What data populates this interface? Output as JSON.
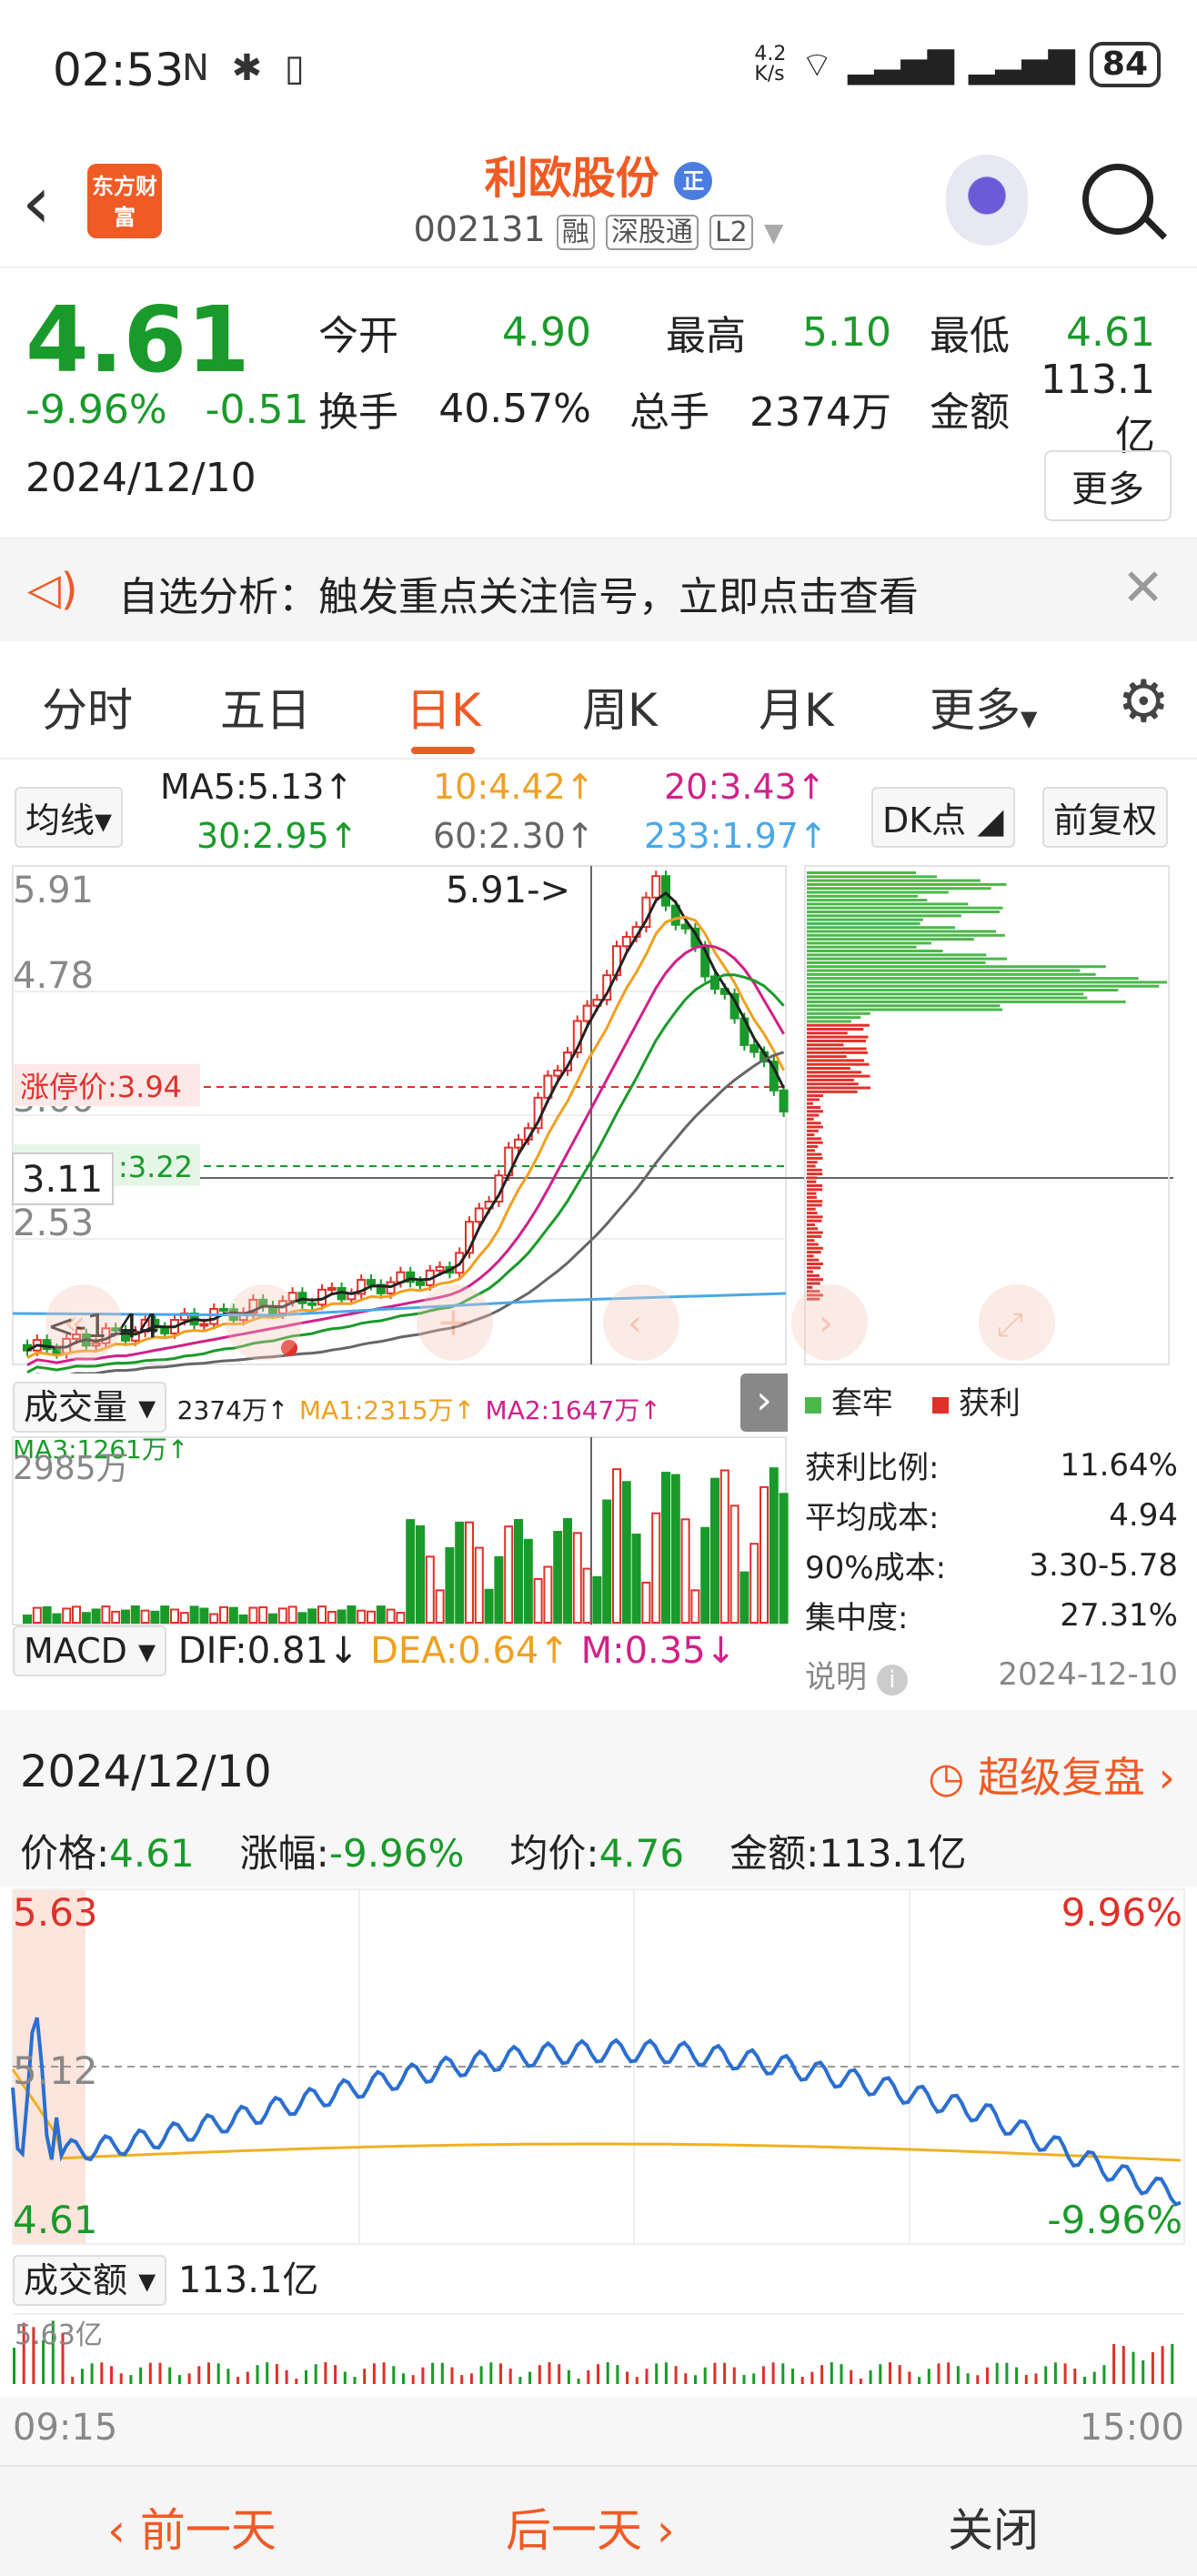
{
  "status": {
    "time": "02:53",
    "icons": "N ✱ ▯",
    "net_speed": "4.2\nK/s",
    "battery": "84"
  },
  "header": {
    "logo_text": "东方财富",
    "stock_name": "利欧股份",
    "name_badge": "正",
    "stock_code": "002131",
    "tags": [
      "融",
      "深股通",
      "L2"
    ]
  },
  "quote": {
    "price": "4.61",
    "change_pct": "-9.96%",
    "change": "-0.51",
    "date": "2024/12/10",
    "fields": [
      [
        {
          "label": "今开",
          "value": "4.90",
          "color": "green"
        },
        {
          "label": "最高",
          "value": "5.10",
          "color": "green"
        },
        {
          "label": "最低",
          "value": "4.61",
          "color": "green"
        }
      ],
      [
        {
          "label": "换手",
          "value": "40.57%",
          "color": "black"
        },
        {
          "label": "总手",
          "value": "2374万",
          "color": "black"
        },
        {
          "label": "金额",
          "value": "113.1亿",
          "color": "black"
        }
      ]
    ],
    "more_label": "更多"
  },
  "notice": {
    "text": "自选分析：触发重点关注信号，立即点击查看"
  },
  "tabs": [
    "分时",
    "五日",
    "日K",
    "周K",
    "月K",
    "更多"
  ],
  "active_tab": "日K",
  "ma_legend": {
    "selector": "均线",
    "ma5": "MA5:5.13↑",
    "ma10": "10:4.42↑",
    "ma20": "20:3.43↑",
    "ma30": "30:2.95↑",
    "ma60": "60:2.30↑",
    "ma233": "233:1.97↑",
    "dk_label": "DK点",
    "adjust_label": "前复权",
    "colors": {
      "ma5": "#222222",
      "ma10": "#f0a020",
      "ma20": "#d0208a",
      "ma30": "#1a9a2a",
      "ma60": "#666666",
      "ma233": "#4aa8e8"
    }
  },
  "kline": {
    "y_labels": [
      "5.91",
      "4.78",
      "3.66",
      "2.53",
      "1.44"
    ],
    "high_marker": "5.91->",
    "crosshair_price": "3.11",
    "limit_label": "涨停价:3.94",
    "cost_label": ":3.22",
    "low_marker": "<-1.44"
  },
  "volume": {
    "selector": "成交量",
    "vol": "2374万↑",
    "ma1": "MA1:2315万↑",
    "ma2": "MA2:1647万↑",
    "ma3": "MA3:1261万↑",
    "max_label": "2985万"
  },
  "macd": {
    "selector": "MACD",
    "dif": "DIF:0.81↓",
    "dea": "DEA:0.64↑",
    "m": "M:0.35↓"
  },
  "chip": {
    "legend_hold": "套牢",
    "legend_profit": "获利",
    "rows": [
      {
        "label": "获利比例:",
        "value": "11.64%"
      },
      {
        "label": "平均成本:",
        "value": "4.94"
      },
      {
        "label": "90%成本:",
        "value": "3.30-5.78"
      },
      {
        "label": "集中度:",
        "value": "27.31%"
      }
    ],
    "note_label": "说明",
    "note_date": "2024-12-10"
  },
  "detail": {
    "date": "2024/12/10",
    "replay": "超级复盘",
    "price_label": "价格:",
    "price": "4.61",
    "pct_label": "涨幅:",
    "pct": "-9.96%",
    "avg_label": "均价:",
    "avg": "4.76",
    "amount_label": "金额:",
    "amount": "113.1亿",
    "y_top": "5.63",
    "y_mid": "5.12",
    "y_bot": "4.61",
    "pct_top": "9.96%",
    "pct_bot": "-9.96%",
    "turnover_selector": "成交额",
    "turnover": "113.1亿",
    "turnover_max": "5.63亿",
    "time_start": "09:15",
    "time_end": "15:00"
  },
  "footer": {
    "prev": "前一天",
    "next": "后一天",
    "close": "关闭"
  }
}
